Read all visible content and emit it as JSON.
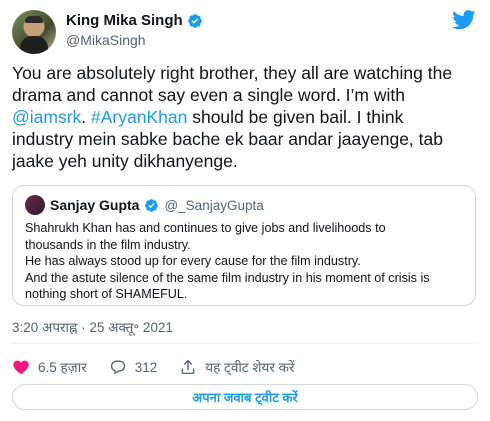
{
  "author": {
    "name": "King Mika Singh",
    "handle": "@MikaSingh"
  },
  "tweet": {
    "line1": "You are absolutely right brother, they all are watching the",
    "line2": "drama and cannot say even a single word. I’m with",
    "mention": "@iamsrk",
    "sep": ". ",
    "hashtag": "#AryanKhan",
    "line3_rest": " should be given bail. I think",
    "line4": "industry mein sabke bache ek baar andar jaayenge, tab",
    "line5": "jaake yeh unity dikhanyenge."
  },
  "quoted_tweet": {
    "name": "Sanjay Gupta",
    "handle": "@_SanjayGupta",
    "lines": [
      "Shahrukh Khan has and continues to give jobs and livelihoods to",
      "thousands in the film industry.",
      "He has always stood up for every cause for the film industry.",
      "And the astute silence of the same film industry in his moment of crisis is",
      "nothing short of SHAMEFUL."
    ]
  },
  "timestamp": "3:20 अपराह्न · 25 अक्तू॰ 2021",
  "actions": {
    "likes": "6.5 हज़ार",
    "replies": "312",
    "share": "यह ट्वीट शेयर करें"
  },
  "reply_button": "अपना जवाब ट्वीट करें",
  "colors": {
    "accent": "#1d9bf0",
    "like_red": "#f91880",
    "text": "#0f1419",
    "muted": "#536471",
    "border": "#cfd9de"
  },
  "icons": [
    "verified-badge-icon",
    "twitter-bird-icon",
    "heart-icon",
    "reply-bubble-icon",
    "share-upload-icon"
  ]
}
